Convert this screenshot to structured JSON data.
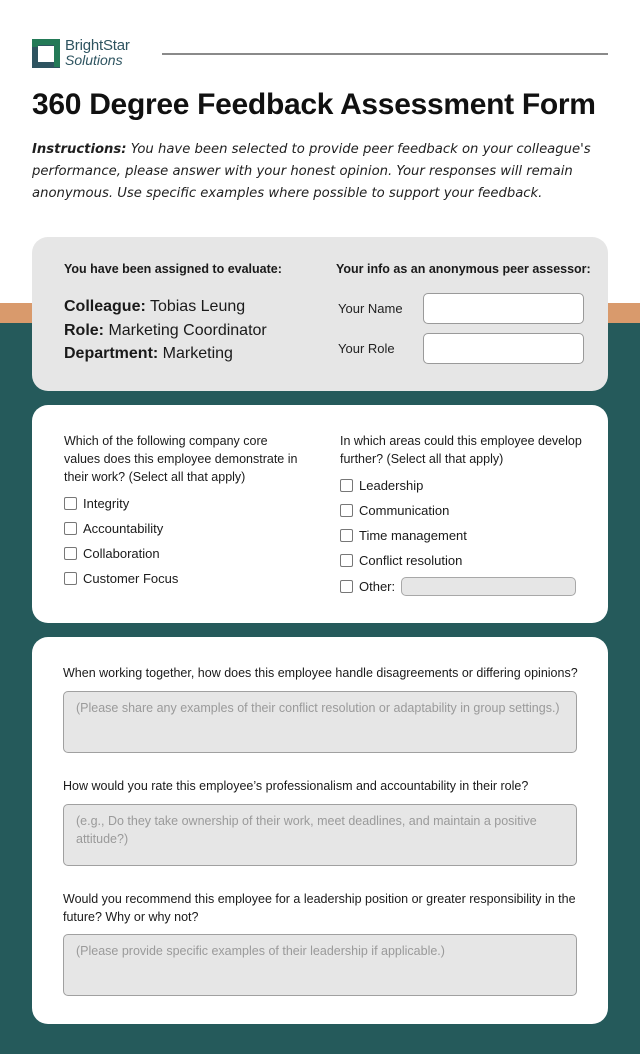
{
  "brand": {
    "name_line1": "BrightStar",
    "name_line2": "Solutions",
    "colors": {
      "logo_green": "#237a57",
      "logo_navy": "#2e5460",
      "teal_band": "#255a5b",
      "orange_band": "#d99a6c",
      "card_grey": "#e6e6e6"
    }
  },
  "header": {
    "title": "360 Degree Feedback Assessment Form",
    "instructions_label": "Instructions:",
    "instructions_text": " You have been selected to provide peer feedback on your colleague's performance, please answer with your honest opinion. Your responses will remain anonymous. Use specific examples where possible to support your feedback."
  },
  "assignment": {
    "heading": "You have been assigned to evaluate:",
    "colleague_label": "Colleague:",
    "colleague_value": " Tobias Leung",
    "role_label": "Role:",
    "role_value": " Marketing Coordinator",
    "department_label": "Department:",
    "department_value": " Marketing"
  },
  "assessor": {
    "heading": "Your info as an anonymous peer assessor:",
    "name_label": "Your Name",
    "name_value": "",
    "role_label": "Your Role",
    "role_value": ""
  },
  "core_values": {
    "question": "Which of the following company core values does this employee demonstrate in their work? (Select all that apply)",
    "options": [
      {
        "label": "Integrity",
        "checked": false
      },
      {
        "label": "Accountability",
        "checked": false
      },
      {
        "label": "Collaboration",
        "checked": false
      },
      {
        "label": "Customer Focus",
        "checked": false
      }
    ]
  },
  "development": {
    "question": "In which areas could this employee develop further? (Select all that apply)",
    "options": [
      {
        "label": "Leadership",
        "checked": false
      },
      {
        "label": "Communication",
        "checked": false
      },
      {
        "label": "Time management",
        "checked": false
      },
      {
        "label": "Conflict resolution",
        "checked": false
      },
      {
        "label": "Other:",
        "checked": false
      }
    ],
    "other_value": ""
  },
  "open_questions": [
    {
      "question": "When working together, how does this employee handle disagreements or differing opinions?",
      "placeholder": "(Please share any examples of their conflict resolution or adaptability in group settings.)"
    },
    {
      "question": "How would you rate this employee’s professionalism and accountability in their role?",
      "placeholder": "(e.g., Do they take ownership of their work, meet deadlines, and maintain a positive attitude?)"
    },
    {
      "question": "Would you recommend this employee for a leadership position or greater responsibility in the future? Why or why not?",
      "placeholder": "(Please provide specific examples of their leadership if applicable.)"
    }
  ]
}
